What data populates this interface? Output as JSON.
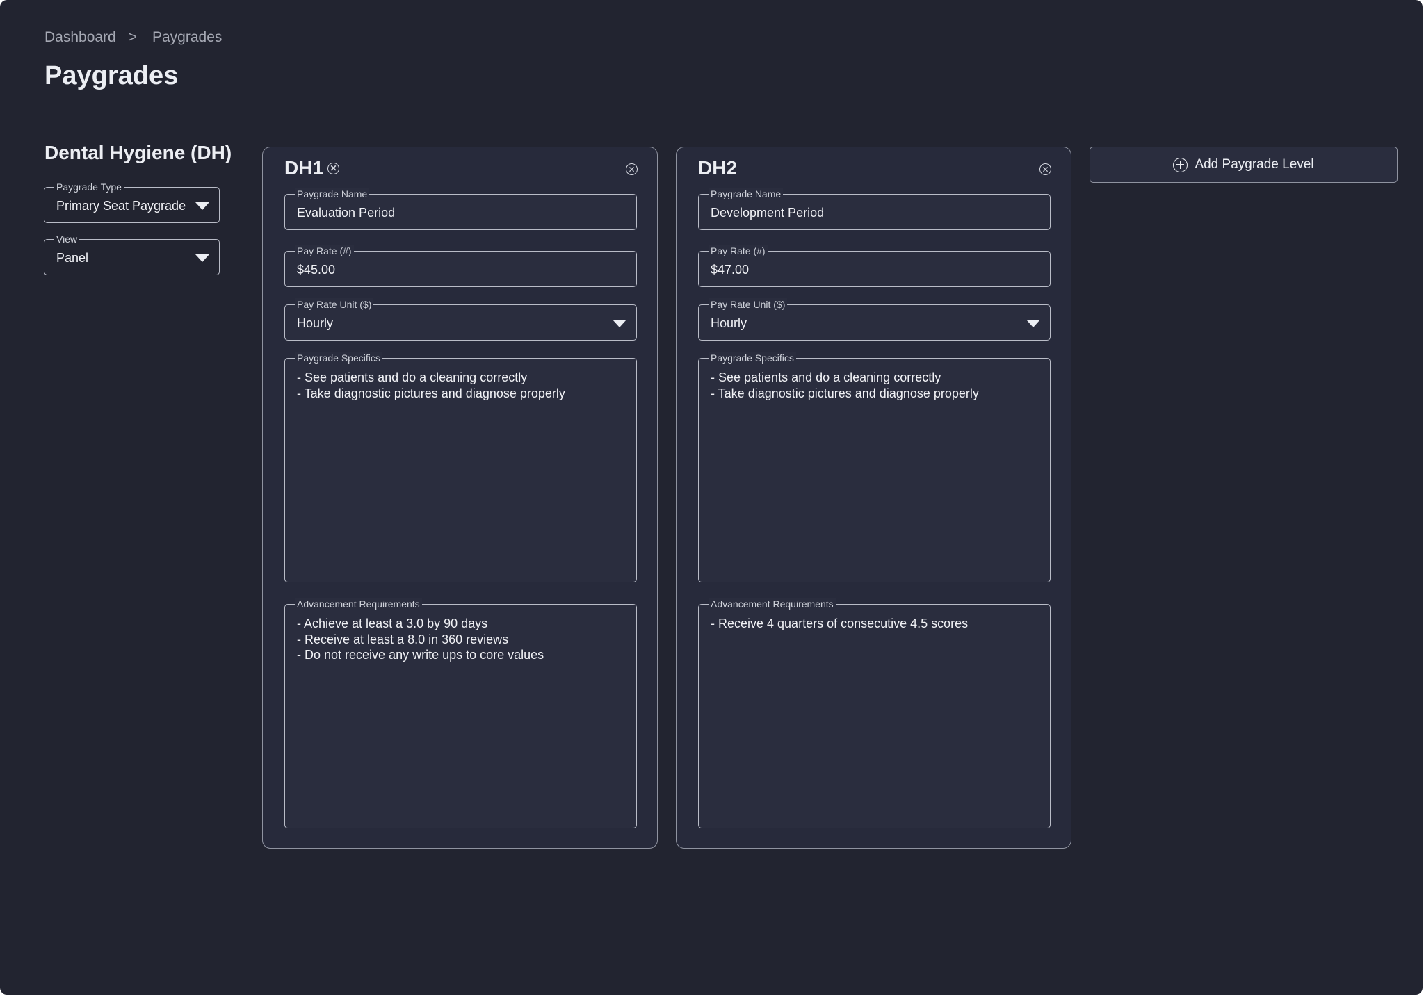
{
  "breadcrumb": {
    "items": [
      "Dashboard",
      "Paygrades"
    ],
    "separator": ">"
  },
  "page": {
    "title": "Paygrades"
  },
  "section": {
    "title": "Dental Hygiene (DH)"
  },
  "filters": {
    "paygrade_type": {
      "label": "Paygrade Type",
      "value": "Primary Seat Paygrade"
    },
    "view": {
      "label": "View",
      "value": "Panel"
    }
  },
  "cards": [
    {
      "title": "DH1",
      "fields": {
        "name": {
          "label": "Paygrade Name",
          "value": "Evaluation Period"
        },
        "pay_rate": {
          "label": "Pay Rate (#)",
          "value": "$45.00"
        },
        "pay_rate_unit": {
          "label": "Pay Rate Unit ($)",
          "value": "Hourly"
        },
        "specifics": {
          "label": "Paygrade Specifics",
          "lines": [
            "- See patients and do a cleaning correctly",
            "- Take diagnostic pictures and diagnose properly"
          ]
        },
        "advancement": {
          "label": "Advancement Requirements",
          "lines": [
            "- Achieve at least a 3.0 by 90 days",
            "- Receive at least a 8.0 in 360 reviews",
            "- Do not receive any write ups to core values"
          ]
        }
      }
    },
    {
      "title": "DH2",
      "fields": {
        "name": {
          "label": "Paygrade Name",
          "value": "Development Period"
        },
        "pay_rate": {
          "label": "Pay Rate (#)",
          "value": "$47.00"
        },
        "pay_rate_unit": {
          "label": "Pay Rate Unit ($)",
          "value": "Hourly"
        },
        "specifics": {
          "label": "Paygrade Specifics",
          "lines": [
            "- See patients and do a cleaning correctly",
            "- Take diagnostic pictures and diagnose properly"
          ]
        },
        "advancement": {
          "label": "Advancement Requirements",
          "lines": [
            "- Receive  4 quarters of consecutive 4.5 scores"
          ]
        }
      }
    }
  ],
  "actions": {
    "add_level": "Add Paygrade Level"
  },
  "icons": {
    "remove": "circle-x-icon",
    "add": "circle-plus-icon",
    "dropdown": "caret-down-icon"
  },
  "colors": {
    "background": "#222430",
    "card": "#272a3b",
    "border": "#b9bcc7",
    "text": "#eceef3"
  }
}
